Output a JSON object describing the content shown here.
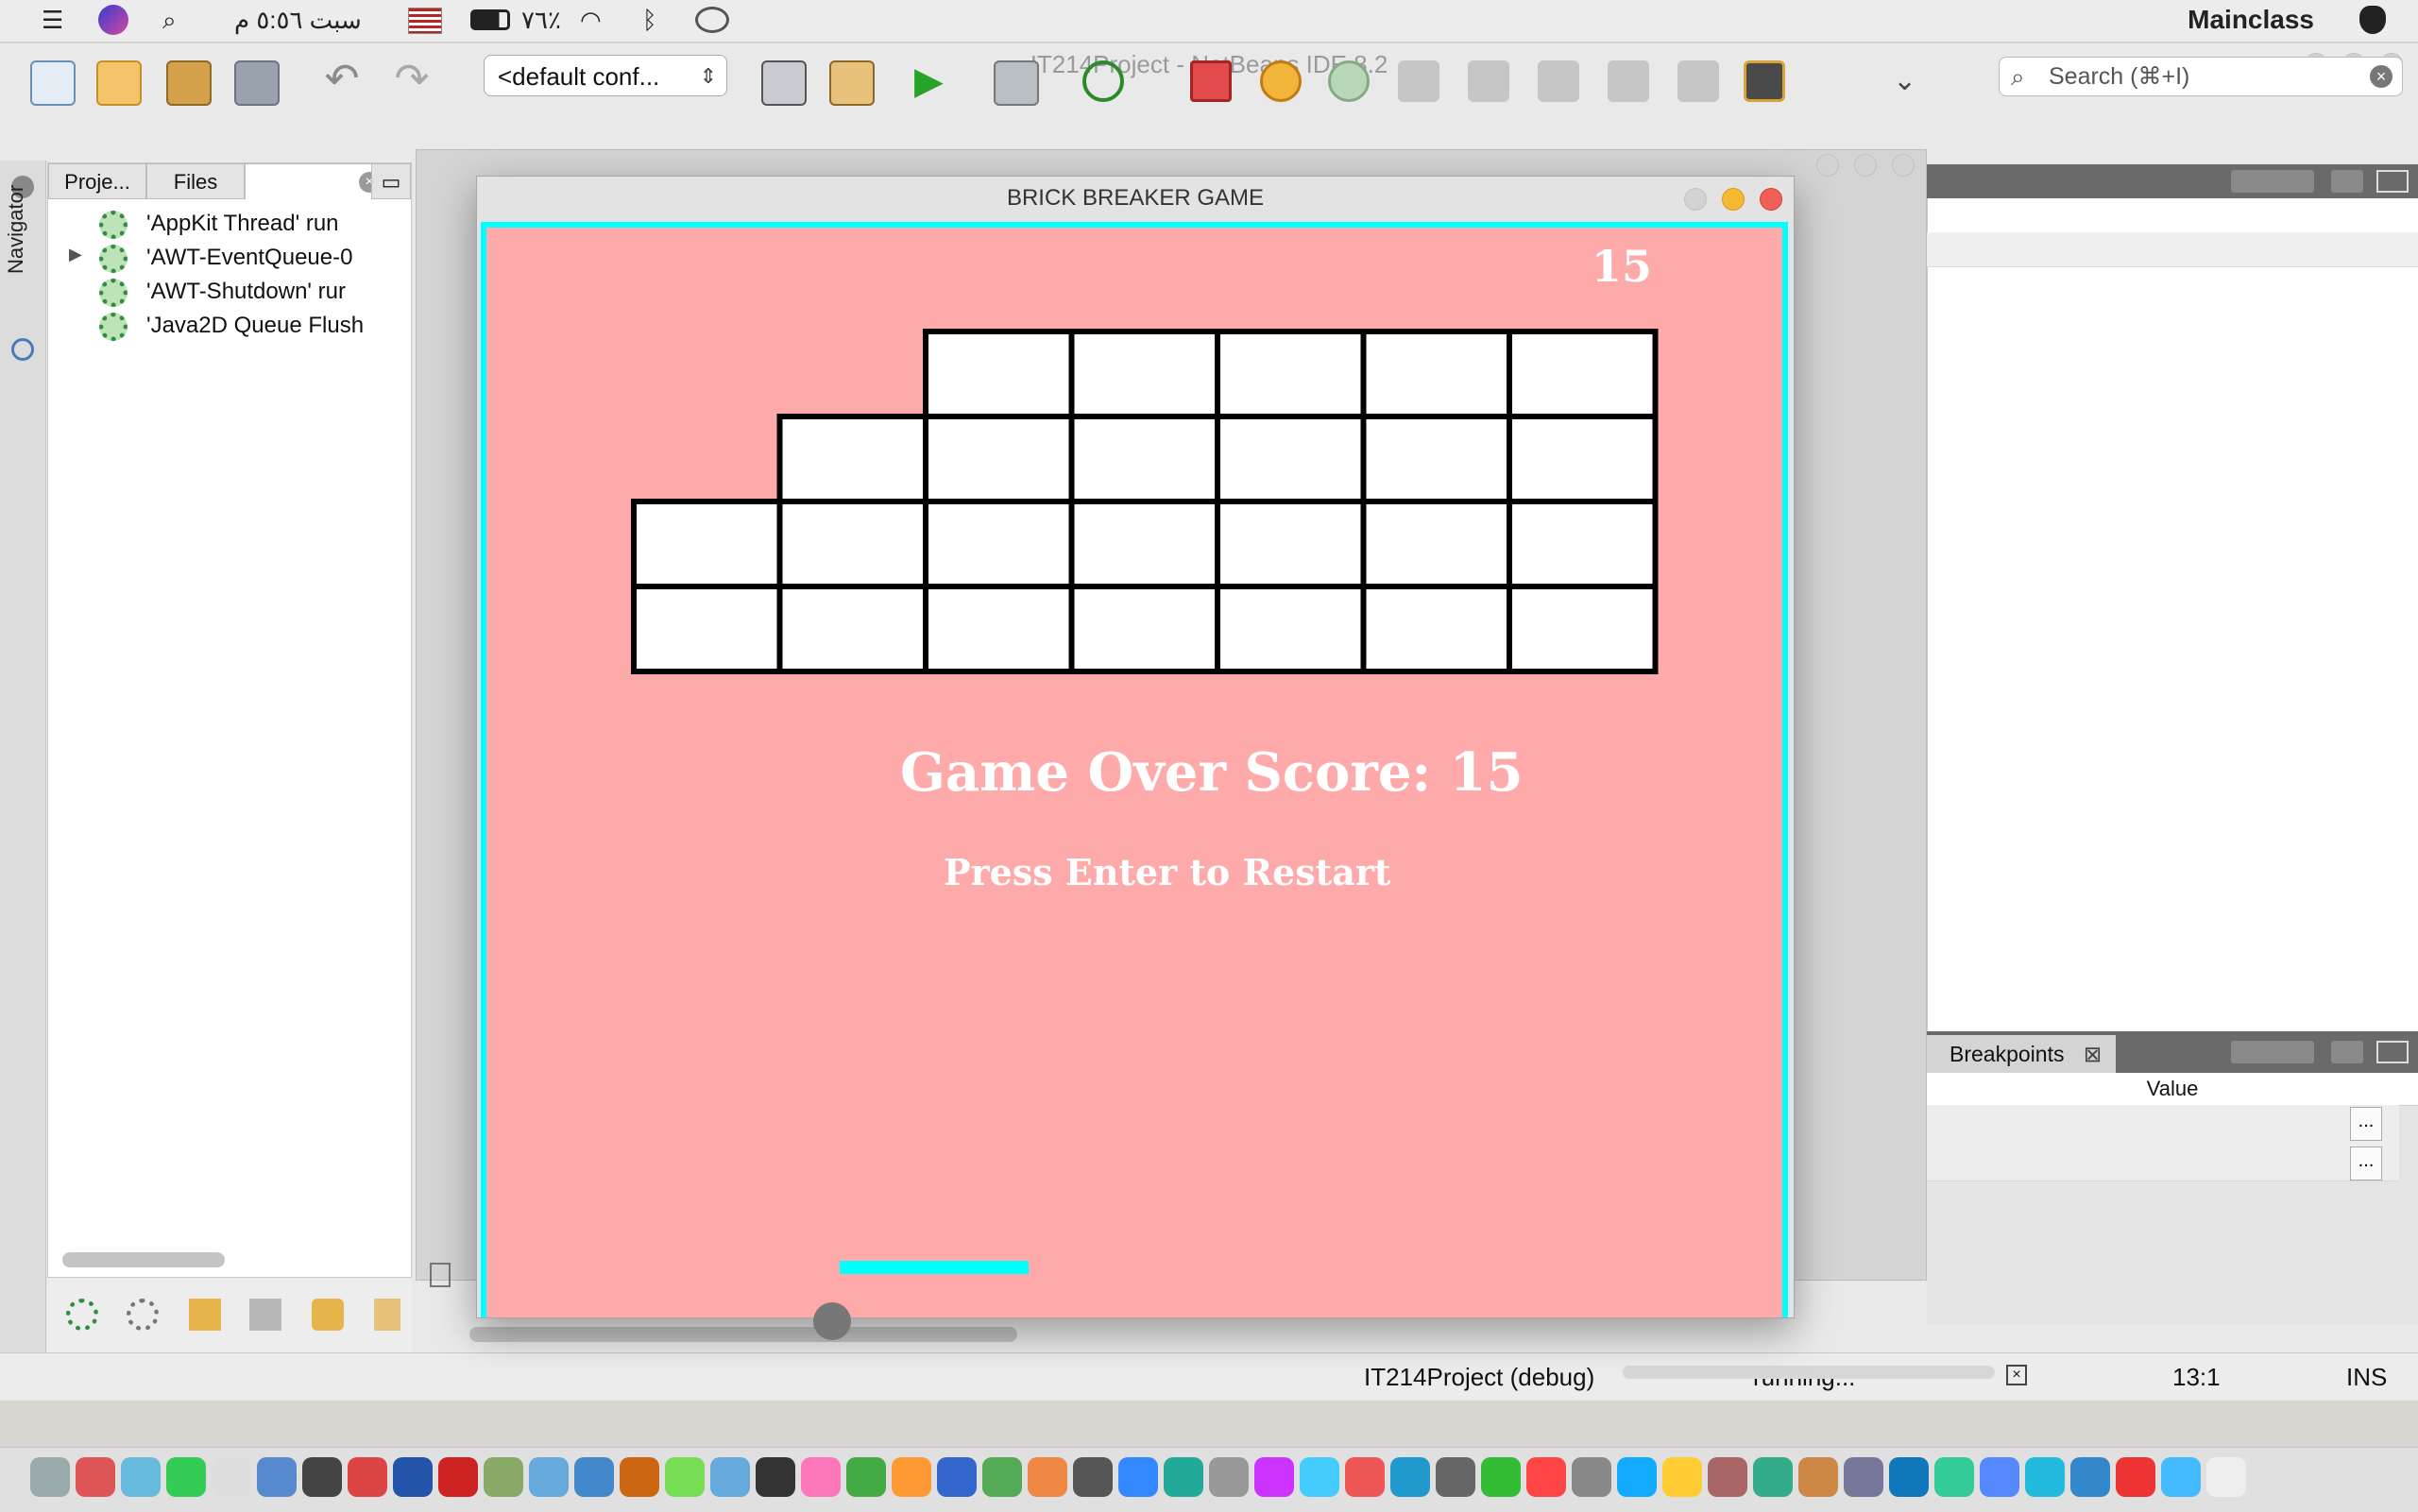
{
  "menubar": {
    "datetime": "سبت ٥:٥٦ م",
    "battery": "٧٦٪",
    "app_name": "Mainclass"
  },
  "ide": {
    "window_title": "IT214Project - NetBeans IDE 8.2",
    "config_select": "<default conf...",
    "search_placeholder": "Search (⌘+I)",
    "navigator_label": "Navigator",
    "tabs": {
      "projects": "Proje...",
      "files": "Files"
    },
    "threads": [
      "'AppKit Thread' run",
      "'AWT-EventQueue-0",
      "'AWT-Shutdown' rur",
      "'Java2D Queue Flush"
    ],
    "breakpoints_tab": "Breakpoints",
    "value_header": "Value",
    "ellipsis": "...",
    "status": {
      "session": "IT214Project (debug)",
      "progress_text": "running...",
      "position": "13:1",
      "mode": "INS"
    }
  },
  "game": {
    "title": "BRICK BREAKER GAME",
    "score_corner": "15",
    "game_over": "Game Over Score: 15",
    "restart": "Press Enter to Restart",
    "colors": {
      "background": "#ffaaaa",
      "border": "#00ffff",
      "paddle": "#00ffff",
      "brick": "#ffffff"
    },
    "bricks": [
      [
        0,
        0,
        1,
        1,
        1,
        1,
        1
      ],
      [
        0,
        1,
        1,
        1,
        1,
        1,
        1
      ],
      [
        1,
        1,
        1,
        1,
        1,
        1,
        1
      ],
      [
        1,
        1,
        1,
        1,
        1,
        1,
        1
      ]
    ]
  },
  "icons": {
    "menubar": [
      "menu-icon",
      "siri-icon",
      "search-icon",
      "flag-icon",
      "battery-icon",
      "wifi-icon",
      "bluetooth-icon",
      "creative-cloud-icon",
      "apple-icon"
    ],
    "toolbar": [
      "new-file-icon",
      "new-project-icon",
      "open-project-icon",
      "save-all-icon",
      "undo-icon",
      "redo-icon",
      "build-icon",
      "clean-build-icon",
      "run-icon",
      "debug-icon",
      "profile-icon",
      "stop-icon",
      "pause-icon",
      "continue-icon",
      "step-over-icon",
      "step-into-icon",
      "step-out-icon",
      "run-to-cursor-icon",
      "apply-changes-icon",
      "screenshot-icon"
    ]
  }
}
